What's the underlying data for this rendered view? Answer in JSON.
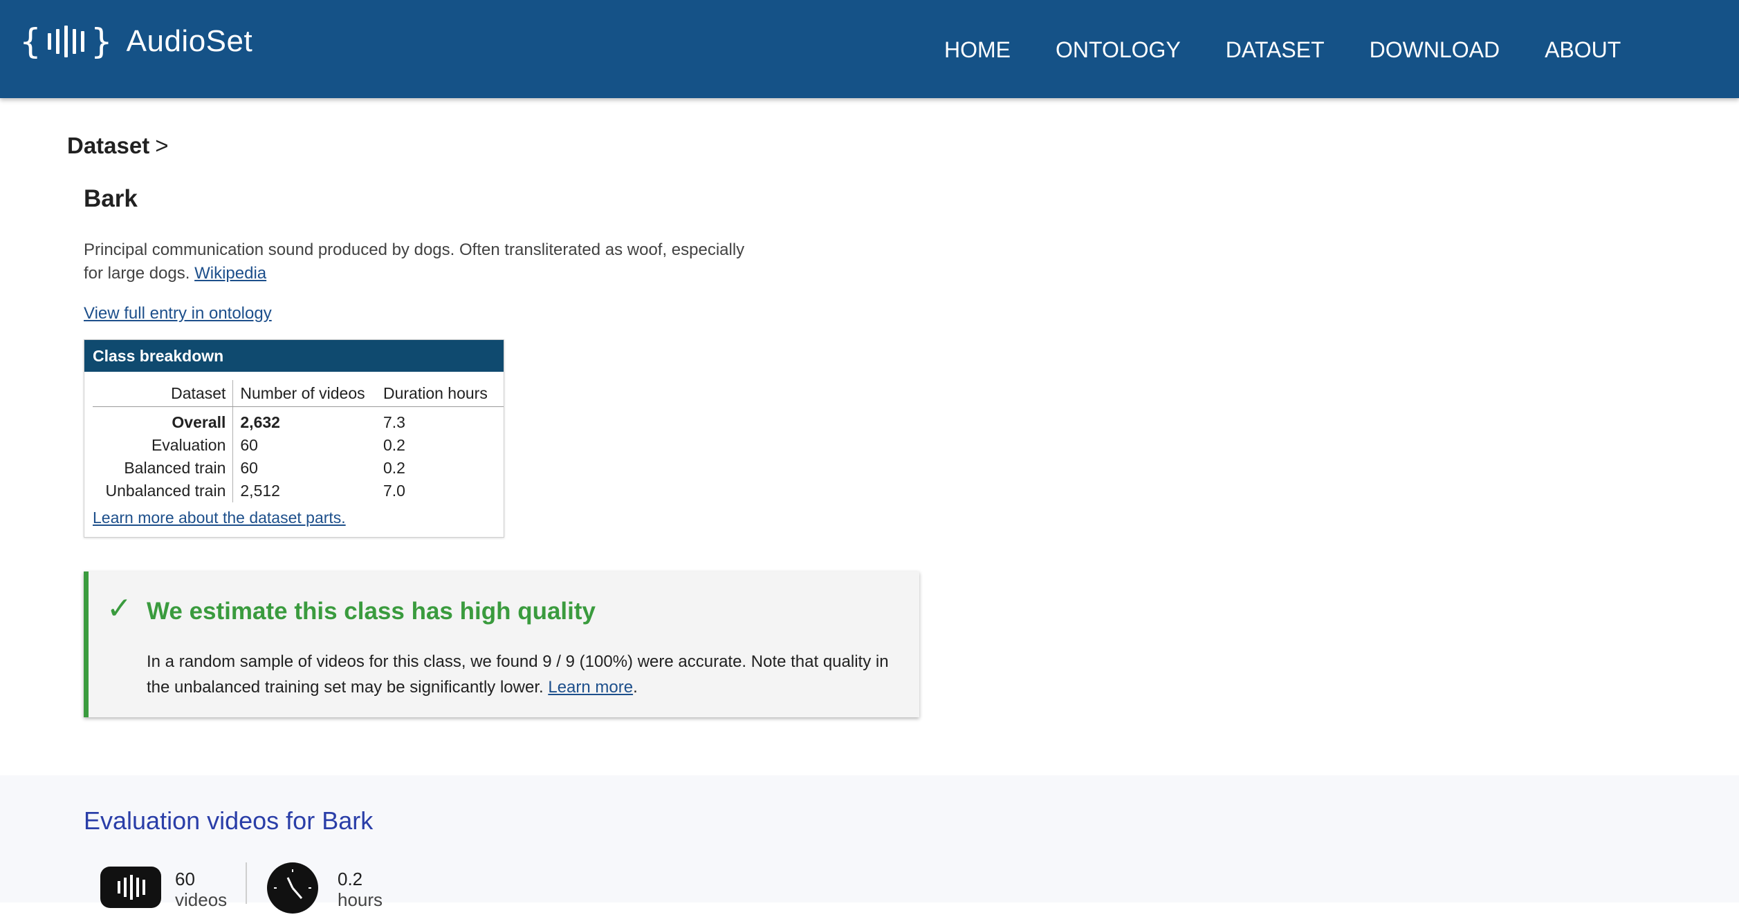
{
  "header": {
    "brand_name": "AudioSet",
    "logo_icon": "audioset-logo-icon",
    "nav": [
      "HOME",
      "ONTOLOGY",
      "DATASET",
      "DOWNLOAD",
      "ABOUT"
    ],
    "color": "#155287"
  },
  "breadcrumb": {
    "label": "Dataset",
    "separator": ">"
  },
  "class": {
    "name": "Bark",
    "description": "Principal communication sound produced by dogs. Often transliterated as woof, especially for large dogs.",
    "wikipedia_link": "Wikipedia",
    "ontology_link": "View full entry in ontology"
  },
  "breakdown": {
    "title": "Class breakdown",
    "columns": [
      "Dataset",
      "Number of videos",
      "Duration hours"
    ],
    "rows": [
      [
        "Overall",
        "2,632",
        "7.3"
      ],
      [
        "Evaluation",
        "60",
        "0.2"
      ],
      [
        "Balanced train",
        "60",
        "0.2"
      ],
      [
        "Unbalanced train",
        "2,512",
        "7.0"
      ]
    ],
    "learn_more": "Learn more about the dataset parts."
  },
  "quality": {
    "icon": "check-icon",
    "title": "We estimate this class has high quality",
    "text": "In a random sample of videos for this class, we found 9 / 9 (100%) were accurate. Note that quality in the unbalanced training set may be significantly lower.",
    "learn_more": "Learn more",
    "trailing": ".",
    "accent": "#3a9b3e"
  },
  "evaluation": {
    "title": "Evaluation videos for Bark",
    "videos_count": "60",
    "videos_unit": "videos",
    "hours_count": "0.2",
    "hours_unit": "hours"
  }
}
